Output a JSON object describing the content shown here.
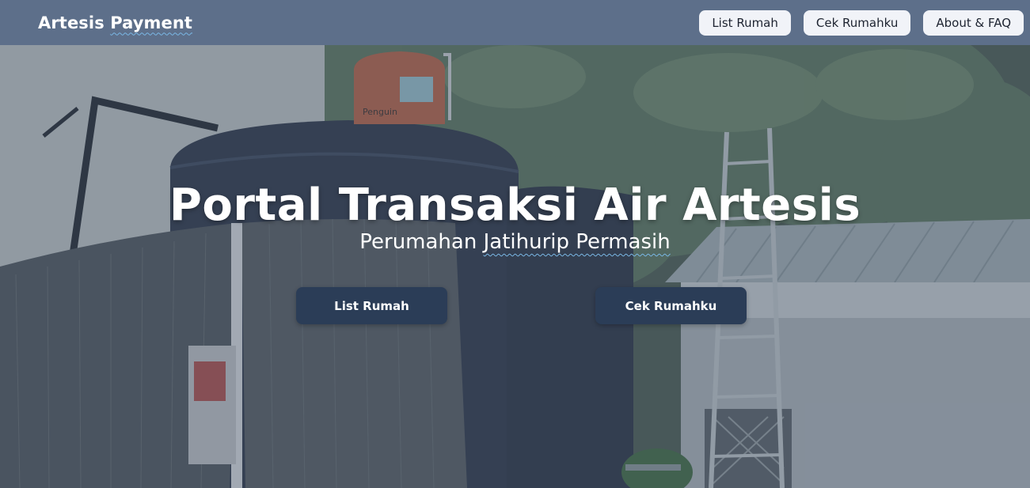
{
  "navbar": {
    "brand_part1": "Artesis",
    "brand_part2": "Payment",
    "links": [
      "List Rumah",
      "Cek Rumahku",
      "About & FAQ"
    ]
  },
  "hero": {
    "title": "Portal Transaksi Air Artesis",
    "subtitle_part1": "Perumahan",
    "subtitle_part2": "Jatihurip Permasih",
    "buttons": [
      "List Rumah",
      "Cek Rumahku"
    ],
    "tank_brand_text": "Penguin"
  },
  "colors": {
    "navbar": "#5d6f8a",
    "nav_button": "#f1f3f8",
    "cta_button": "#2b3d57",
    "spellcheck_underline": "#7ab8e6"
  }
}
